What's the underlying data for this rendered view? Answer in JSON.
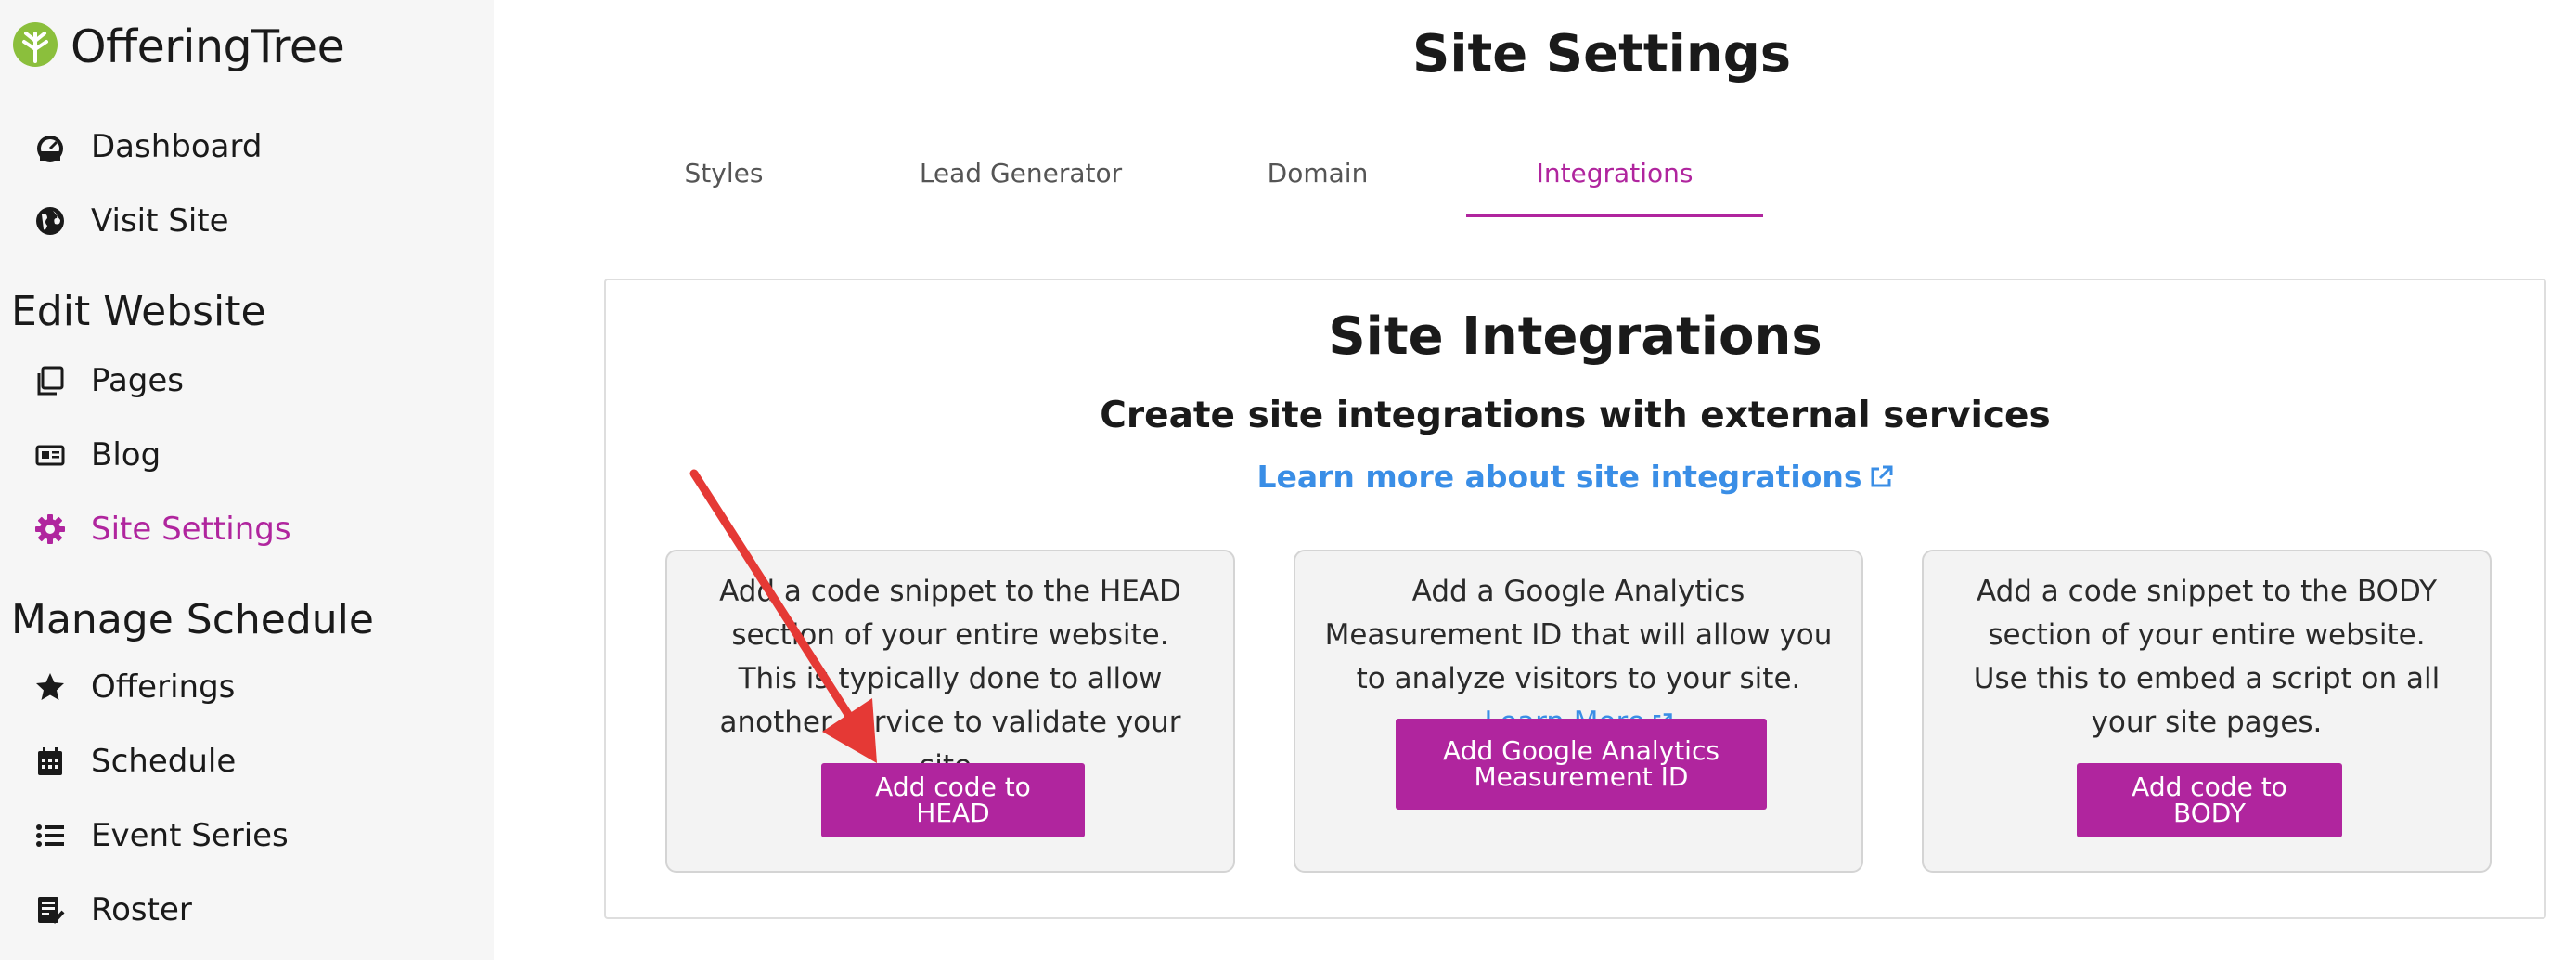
{
  "brand": {
    "name": "OfferingTree",
    "accent": "#b0259e",
    "logo_color": "#8bbf3c"
  },
  "sidebar": {
    "top_items": [
      {
        "label": "Dashboard",
        "icon": "speedometer-icon"
      },
      {
        "label": "Visit Site",
        "icon": "globe-icon"
      }
    ],
    "sections": [
      {
        "title": "Edit Website",
        "items": [
          {
            "label": "Pages",
            "icon": "pages-icon"
          },
          {
            "label": "Blog",
            "icon": "newspaper-icon"
          },
          {
            "label": "Site Settings",
            "icon": "gear-icon",
            "active": true
          }
        ]
      },
      {
        "title": "Manage Schedule",
        "items": [
          {
            "label": "Offerings",
            "icon": "star-icon"
          },
          {
            "label": "Schedule",
            "icon": "calendar-icon"
          },
          {
            "label": "Event Series",
            "icon": "list-icon"
          },
          {
            "label": "Roster",
            "icon": "roster-icon"
          }
        ]
      }
    ]
  },
  "main": {
    "title": "Site Settings",
    "tabs": [
      {
        "label": "Styles"
      },
      {
        "label": "Lead Generator"
      },
      {
        "label": "Domain"
      },
      {
        "label": "Integrations",
        "active": true
      }
    ],
    "panel": {
      "title": "Site Integrations",
      "subtitle": "Create site integrations with external services",
      "learn_link": "Learn more about site integrations",
      "cards": [
        {
          "text": "Add a code snippet to the HEAD section of your entire website. This is typically done to allow another service to validate your site.",
          "button": "Add code to HEAD"
        },
        {
          "text": "Add a Google Analytics Measurement ID that will allow you to analyze visitors to your site.",
          "link": "Learn More",
          "button": "Add Google Analytics Measurement ID"
        },
        {
          "text": "Add a code snippet to the BODY section of your entire website. Use this to embed a script on all your site pages.",
          "button": "Add code to BODY"
        }
      ]
    }
  },
  "annotation": {
    "arrow_color": "#e53935"
  }
}
